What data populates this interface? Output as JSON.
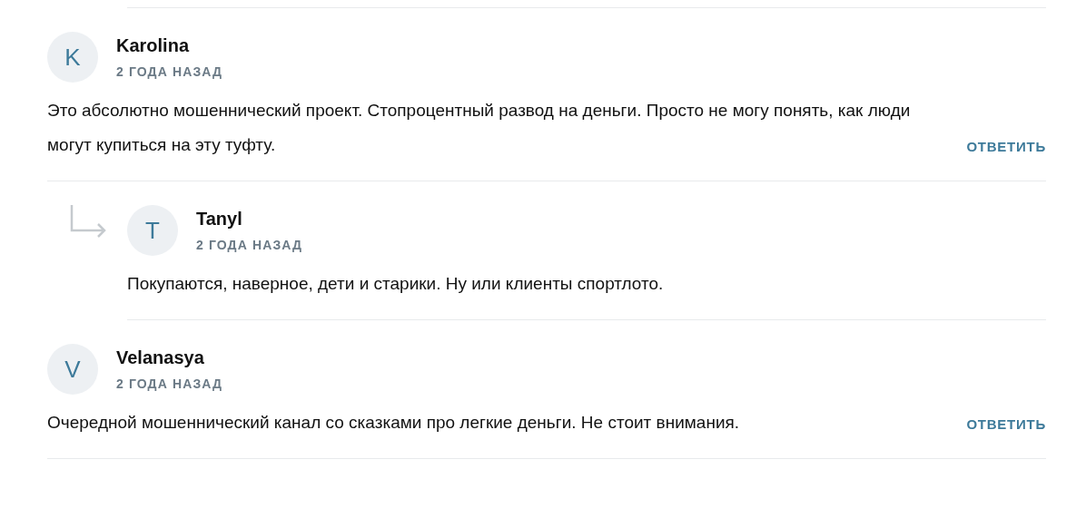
{
  "comments": [
    {
      "avatar": "K",
      "name": "Karolina",
      "time": "2 ГОДА НАЗАД",
      "text": "Это абсолютно мошеннический проект. Стопроцентный развод на деньги. Просто не могу понять, как люди могут купиться на эту туфту.",
      "reply_button": "ОТВЕТИТЬ",
      "replies": [
        {
          "avatar": "T",
          "name": "Tanyl",
          "time": "2 ГОДА НАЗАД",
          "text": "Покупаются, наверное, дети и старики. Ну или клиенты спортлото."
        }
      ]
    },
    {
      "avatar": "V",
      "name": "Velanasya",
      "time": "2 ГОДА НАЗАД",
      "text": "Очередной мошеннический канал со сказками про легкие деньги. Не стоит внимания.",
      "reply_button": "ОТВЕТИТЬ"
    }
  ]
}
